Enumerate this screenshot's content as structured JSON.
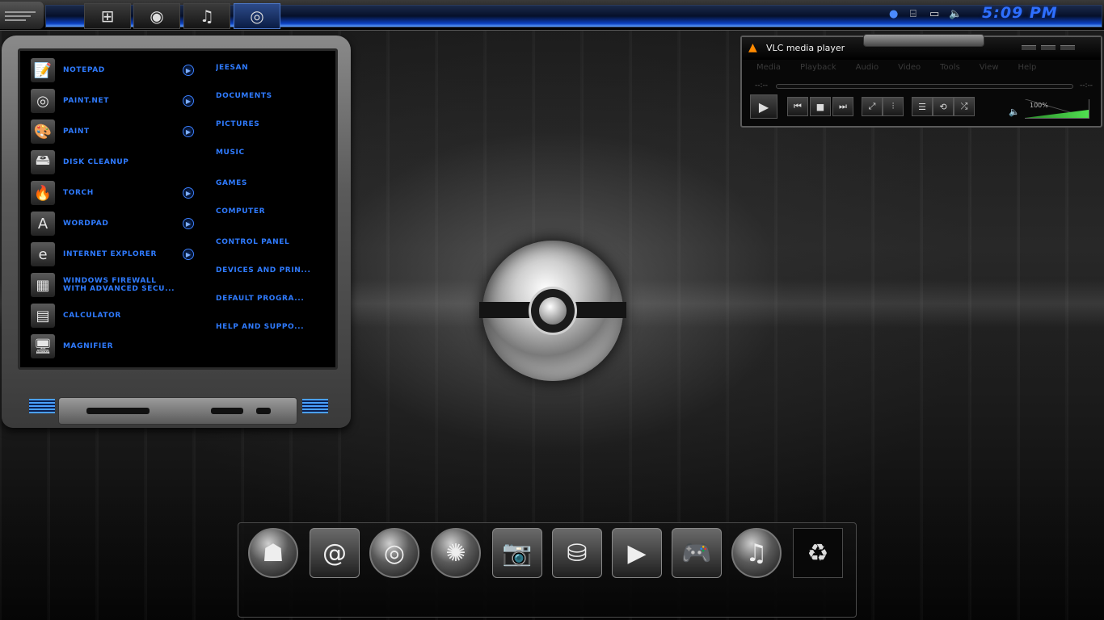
{
  "taskbar": {
    "buttons": [
      {
        "name": "windows-icon",
        "glyph": "⊞"
      },
      {
        "name": "disc-icon",
        "glyph": "◉"
      },
      {
        "name": "music-icon",
        "glyph": "♫"
      },
      {
        "name": "paint-net-icon",
        "glyph": "◎"
      }
    ],
    "tray": [
      {
        "name": "network-globe-icon",
        "glyph": "●"
      },
      {
        "name": "usb-icon",
        "glyph": "⌸"
      },
      {
        "name": "display-icon",
        "glyph": "▭"
      },
      {
        "name": "volume-icon",
        "glyph": "🔈"
      }
    ],
    "clock": "5:09 PM"
  },
  "start_menu": {
    "programs": [
      {
        "label": "NOTEPAD",
        "icon": "notepad-icon",
        "glyph": "📝",
        "arrow": true
      },
      {
        "label": "PAINT.NET",
        "icon": "paint-net-icon",
        "glyph": "◎",
        "arrow": true
      },
      {
        "label": "PAINT",
        "icon": "paint-palette-icon",
        "glyph": "🎨",
        "arrow": true
      },
      {
        "label": "DISK CLEANUP",
        "icon": "disk-cleanup-icon",
        "glyph": "🖴",
        "arrow": false
      },
      {
        "label": "TORCH",
        "icon": "torch-icon",
        "glyph": "🔥",
        "arrow": true
      },
      {
        "label": "WORDPAD",
        "icon": "wordpad-icon",
        "glyph": "A",
        "arrow": true
      },
      {
        "label": "INTERNET EXPLORER",
        "icon": "internet-explorer-icon",
        "glyph": "e",
        "arrow": true
      },
      {
        "label": "WINDOWS FIREWALL\nWITH ADVANCED SECU...",
        "icon": "firewall-icon",
        "glyph": "▦",
        "arrow": false
      },
      {
        "label": "CALCULATOR",
        "icon": "calculator-icon",
        "glyph": "▤",
        "arrow": false
      },
      {
        "label": "MAGNIFIER",
        "icon": "magnifier-icon",
        "glyph": "🖥",
        "arrow": false
      }
    ],
    "places": [
      "JEESAN",
      "DOCUMENTS",
      "PICTURES",
      "MUSIC",
      "GAMES",
      "COMPUTER",
      "CONTROL PANEL",
      "DEVICES AND PRIN...",
      "DEFAULT PROGRA...",
      "HELP AND SUPPO..."
    ]
  },
  "vlc": {
    "title": "VLC media player",
    "menu": [
      "Media",
      "Playback",
      "Audio",
      "Video",
      "Tools",
      "View",
      "Help"
    ],
    "time_left": "--:--",
    "time_right": "--:--",
    "volume_label": "100%",
    "volume": 1.0,
    "buttons": [
      {
        "name": "prev-icon",
        "glyph": "⏮"
      },
      {
        "name": "stop-icon",
        "glyph": "■"
      },
      {
        "name": "next-icon",
        "glyph": "⏭"
      },
      {
        "name": "fullscreen-icon",
        "glyph": "⤢"
      },
      {
        "name": "extended-settings-icon",
        "glyph": "⫶"
      },
      {
        "name": "playlist-icon",
        "glyph": "☰"
      },
      {
        "name": "loop-icon",
        "glyph": "⟲"
      },
      {
        "name": "shuffle-icon",
        "glyph": "⤮"
      }
    ]
  },
  "dock": {
    "items": [
      {
        "name": "horde-emblem-icon",
        "glyph": "☗",
        "shape": "round"
      },
      {
        "name": "mail-icon",
        "glyph": "@",
        "shape": "sq"
      },
      {
        "name": "dvd-icon",
        "glyph": "◎",
        "shape": "round"
      },
      {
        "name": "widgets-icon",
        "glyph": "✺",
        "shape": "round"
      },
      {
        "name": "photos-icon",
        "glyph": "📷",
        "shape": "sq"
      },
      {
        "name": "drive-icon",
        "glyph": "⛁",
        "shape": "sq"
      },
      {
        "name": "video-player-icon",
        "glyph": "▶",
        "shape": "sq"
      },
      {
        "name": "gamepad-icon",
        "glyph": "🎮",
        "shape": "sq"
      },
      {
        "name": "music-icon",
        "glyph": "♫",
        "shape": "round"
      },
      {
        "name": "recycle-bin-icon",
        "glyph": "♻",
        "shape": "recycle"
      }
    ]
  },
  "colors": {
    "accent_blue": "#2f7bff",
    "vlc_cone": "#ff8a00",
    "volume_green": "#50e050"
  }
}
